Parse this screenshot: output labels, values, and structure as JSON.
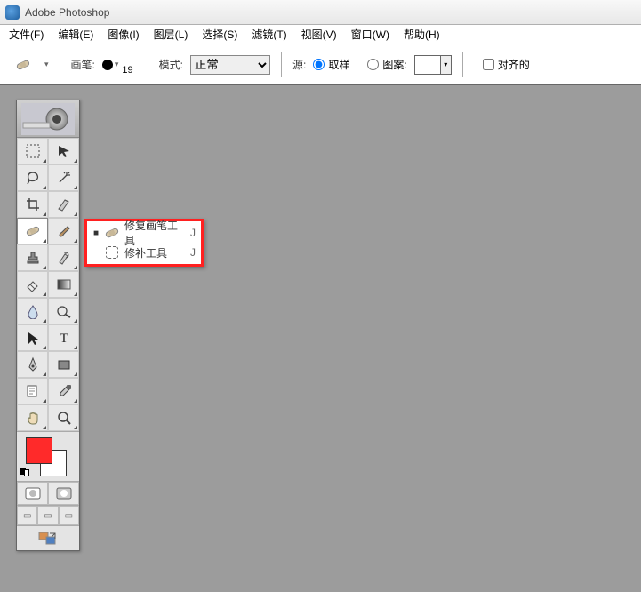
{
  "app": {
    "title": "Adobe Photoshop"
  },
  "menu": {
    "file": "文件(F)",
    "edit": "编辑(E)",
    "image": "图像(I)",
    "layer": "图层(L)",
    "select": "选择(S)",
    "filter": "滤镜(T)",
    "view": "视图(V)",
    "window": "窗口(W)",
    "help": "帮助(H)"
  },
  "options": {
    "brush_label": "画笔:",
    "brush_size": "19",
    "mode_label": "模式:",
    "mode_value": "正常",
    "source_label": "源:",
    "sample_label": "取样",
    "pattern_label": "图案:",
    "dropdown_arrow": "▾",
    "aligned_label": "对齐的"
  },
  "toolbox_header": "◯",
  "tools": [
    {
      "name": "marquee-tool",
      "icon": "marquee"
    },
    {
      "name": "move-tool",
      "icon": "move"
    },
    {
      "name": "lasso-tool",
      "icon": "lasso"
    },
    {
      "name": "wand-tool",
      "icon": "wand"
    },
    {
      "name": "crop-tool",
      "icon": "crop"
    },
    {
      "name": "slice-tool",
      "icon": "slice"
    },
    {
      "name": "healing-brush-tool",
      "icon": "bandaid",
      "selected": true
    },
    {
      "name": "brush-tool",
      "icon": "brush"
    },
    {
      "name": "stamp-tool",
      "icon": "stamp"
    },
    {
      "name": "history-brush-tool",
      "icon": "history"
    },
    {
      "name": "eraser-tool",
      "icon": "eraser"
    },
    {
      "name": "gradient-tool",
      "icon": "gradient"
    },
    {
      "name": "blur-tool",
      "icon": "blur"
    },
    {
      "name": "dodge-tool",
      "icon": "dodge"
    },
    {
      "name": "path-select-tool",
      "icon": "arrow"
    },
    {
      "name": "type-tool",
      "icon": "type"
    },
    {
      "name": "pen-tool",
      "icon": "pen"
    },
    {
      "name": "shape-tool",
      "icon": "rect"
    },
    {
      "name": "notes-tool",
      "icon": "note"
    },
    {
      "name": "eyedropper-tool",
      "icon": "eyedrop"
    },
    {
      "name": "hand-tool",
      "icon": "hand"
    },
    {
      "name": "zoom-tool",
      "icon": "zoom"
    }
  ],
  "colors": {
    "fg": "#ff2a2a",
    "bg": "#ffffff"
  },
  "flyout": {
    "items": [
      {
        "label": "修复画笔工具",
        "shortcut": "J",
        "active": true,
        "icon": "bandaid"
      },
      {
        "label": "修补工具",
        "shortcut": "J",
        "active": false,
        "icon": "patch"
      }
    ]
  }
}
